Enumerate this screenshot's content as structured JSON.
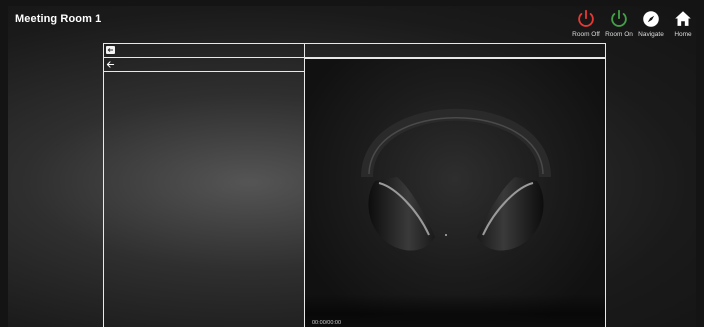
{
  "header": {
    "room_title": "Meeting Room 1"
  },
  "actions": [
    {
      "label": "Room Off",
      "icon": "power-icon",
      "color": "#e53935"
    },
    {
      "label": "Room On",
      "icon": "power-icon",
      "color": "#43a047"
    },
    {
      "label": "Navigate",
      "icon": "compass-icon",
      "color": "#ffffff"
    },
    {
      "label": "Home",
      "icon": "home-icon",
      "color": "#ffffff"
    }
  ],
  "player": {
    "time": "00:00/00:00",
    "media_subject": "headphones"
  }
}
